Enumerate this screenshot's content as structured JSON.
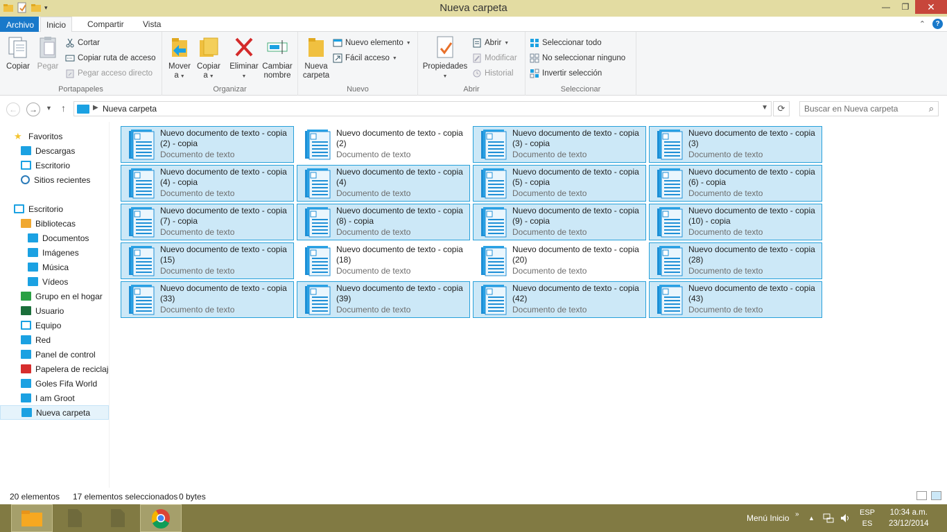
{
  "window": {
    "title": "Nueva carpeta"
  },
  "ribbon_tabs": [
    "Archivo",
    "Inicio",
    "Compartir",
    "Vista"
  ],
  "ribbon": {
    "portapapeles": {
      "label": "Portapapeles",
      "copiar": "Copiar",
      "pegar": "Pegar",
      "cortar": "Cortar",
      "copiar_ruta": "Copiar ruta de acceso",
      "pegar_acceso": "Pegar acceso directo"
    },
    "organizar": {
      "label": "Organizar",
      "mover_a": "Mover",
      "mover_a2": "a",
      "copiar_a": "Copiar",
      "copiar_a2": "a",
      "eliminar": "Eliminar",
      "cambiar": "Cambiar",
      "cambiar2": "nombre"
    },
    "nuevo": {
      "label": "Nuevo",
      "nueva_carpeta": "Nueva",
      "nueva_carpeta2": "carpeta",
      "nuevo_elemento": "Nuevo elemento",
      "facil_acceso": "Fácil acceso"
    },
    "abrir": {
      "label": "Abrir",
      "propiedades": "Propiedades",
      "abrir": "Abrir",
      "modificar": "Modificar",
      "historial": "Historial"
    },
    "seleccionar": {
      "label": "Seleccionar",
      "todo": "Seleccionar todo",
      "ninguno": "No seleccionar ninguno",
      "invertir": "Invertir selección"
    }
  },
  "address": {
    "path": "Nueva carpeta",
    "search_placeholder": "Buscar en Nueva carpeta"
  },
  "nav": [
    {
      "label": "Favoritos",
      "icon": "star-icon",
      "color": "#f4c430"
    },
    {
      "label": "Descargas",
      "icon": "downloads-folder-icon",
      "color": "#1ba1e2"
    },
    {
      "label": "Escritorio",
      "icon": "desktop-icon",
      "color": "#1ba1e2"
    },
    {
      "label": "Sitios recientes",
      "icon": "clock-icon",
      "color": "#2b7bb9"
    },
    {
      "label": "Escritorio",
      "icon": "desktop-icon",
      "color": "#1ba1e2"
    },
    {
      "label": "Bibliotecas",
      "icon": "libraries-icon",
      "color": "#f0a830"
    },
    {
      "label": "Documentos",
      "icon": "documents-icon",
      "color": "#1ba1e2"
    },
    {
      "label": "Imágenes",
      "icon": "pictures-icon",
      "color": "#1ba1e2"
    },
    {
      "label": "Música",
      "icon": "music-icon",
      "color": "#1ba1e2"
    },
    {
      "label": "Vídeos",
      "icon": "videos-icon",
      "color": "#1ba1e2"
    },
    {
      "label": "Grupo en el hogar",
      "icon": "homegroup-icon",
      "color": "#2aa043"
    },
    {
      "label": "Usuario",
      "icon": "user-folder-icon",
      "color": "#1b6e3a"
    },
    {
      "label": "Equipo",
      "icon": "computer-icon",
      "color": "#1ba1e2"
    },
    {
      "label": "Red",
      "icon": "network-icon",
      "color": "#1ba1e2"
    },
    {
      "label": "Panel de control",
      "icon": "control-panel-icon",
      "color": "#1ba1e2"
    },
    {
      "label": "Papelera de reciclaje",
      "icon": "recycle-bin-icon",
      "color": "#d62d2d"
    },
    {
      "label": "Goles Fifa World",
      "icon": "folder-icon",
      "color": "#1ba1e2"
    },
    {
      "label": "I am Groot",
      "icon": "folder-icon",
      "color": "#1ba1e2"
    },
    {
      "label": "Nueva carpeta",
      "icon": "folder-icon",
      "color": "#1ba1e2"
    }
  ],
  "files": [
    {
      "line1": "Nuevo documento de texto - copia",
      "line2": "(2) - copia",
      "type": "Documento de texto",
      "selected": true
    },
    {
      "line1": "Nuevo documento de texto - copia",
      "line2": "(2)",
      "type": "Documento de texto",
      "selected": false
    },
    {
      "line1": "Nuevo documento de texto - copia",
      "line2": "(3) - copia",
      "type": "Documento de texto",
      "selected": true
    },
    {
      "line1": "Nuevo documento de texto - copia",
      "line2": "(3)",
      "type": "Documento de texto",
      "selected": true
    },
    {
      "line1": "Nuevo documento de texto - copia",
      "line2": "(4) - copia",
      "type": "Documento de texto",
      "selected": true
    },
    {
      "line1": "Nuevo documento de texto - copia",
      "line2": "(4)",
      "type": "Documento de texto",
      "selected": true
    },
    {
      "line1": "Nuevo documento de texto - copia",
      "line2": "(5) - copia",
      "type": "Documento de texto",
      "selected": true
    },
    {
      "line1": "Nuevo documento de texto - copia",
      "line2": "(6) - copia",
      "type": "Documento de texto",
      "selected": true
    },
    {
      "line1": "Nuevo documento de texto - copia",
      "line2": "(7) - copia",
      "type": "Documento de texto",
      "selected": true
    },
    {
      "line1": "Nuevo documento de texto - copia",
      "line2": "(8) - copia",
      "type": "Documento de texto",
      "selected": true
    },
    {
      "line1": "Nuevo documento de texto - copia",
      "line2": "(9) - copia",
      "type": "Documento de texto",
      "selected": true
    },
    {
      "line1": "Nuevo documento de texto - copia",
      "line2": "(10) - copia",
      "type": "Documento de texto",
      "selected": true
    },
    {
      "line1": "Nuevo documento de texto - copia",
      "line2": "(15)",
      "type": "Documento de texto",
      "selected": true
    },
    {
      "line1": "Nuevo documento de texto - copia",
      "line2": "(18)",
      "type": "Documento de texto",
      "selected": false
    },
    {
      "line1": "Nuevo documento de texto - copia",
      "line2": "(20)",
      "type": "Documento de texto",
      "selected": false
    },
    {
      "line1": "Nuevo documento de texto - copia",
      "line2": "(28)",
      "type": "Documento de texto",
      "selected": true
    },
    {
      "line1": "Nuevo documento de texto - copia",
      "line2": "(33)",
      "type": "Documento de texto",
      "selected": true
    },
    {
      "line1": "Nuevo documento de texto - copia",
      "line2": "(39)",
      "type": "Documento de texto",
      "selected": true
    },
    {
      "line1": "Nuevo documento de texto - copia",
      "line2": "(42)",
      "type": "Documento de texto",
      "selected": true
    },
    {
      "line1": "Nuevo documento de texto - copia",
      "line2": "(43)",
      "type": "Documento de texto",
      "selected": true
    }
  ],
  "status": {
    "count": "20 elementos",
    "selected": "17 elementos seleccionados",
    "size": "0 bytes"
  },
  "taskbar": {
    "menu_inicio": "Menú Inicio",
    "lang1": "ESP",
    "lang2": "ES",
    "time": "10:34 a.m.",
    "date": "23/12/2014"
  },
  "colors": {
    "selection_fill": "#cce8f7",
    "selection_border": "#26a0da",
    "titlebar": "#e3dca2",
    "taskbar": "#817a43",
    "accent": "#1979ca"
  }
}
